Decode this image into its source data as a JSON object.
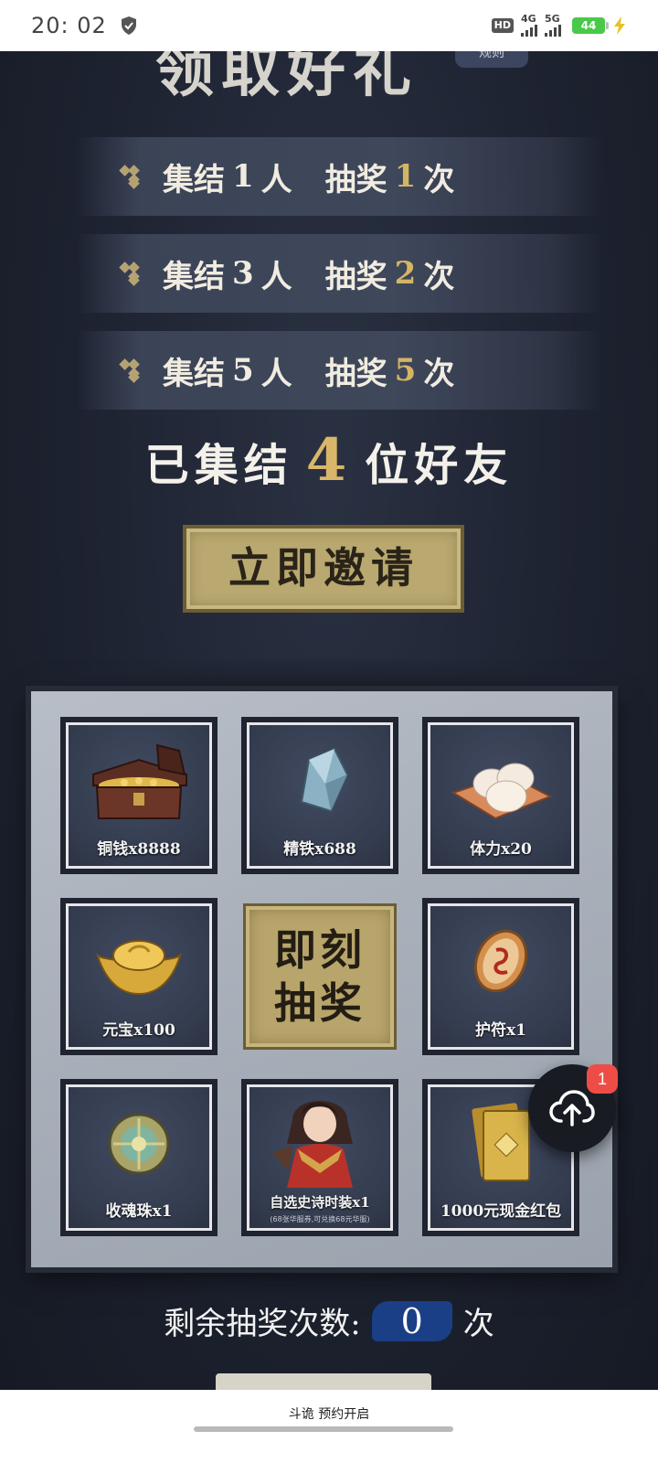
{
  "status_bar": {
    "time": "20: 02",
    "hd_label": "HD",
    "signal_1_label": "4G",
    "signal_2_label": "5G",
    "battery": "44"
  },
  "header": {
    "title_fragment": "领取好礼",
    "rules_label": "规则"
  },
  "tiers": [
    {
      "prefix": "集结",
      "people": "1",
      "people_unit": "人",
      "draw_text": "抽奖",
      "draws": "1",
      "draw_unit": "次"
    },
    {
      "prefix": "集结",
      "people": "3",
      "people_unit": "人",
      "draw_text": "抽奖",
      "draws": "2",
      "draw_unit": "次"
    },
    {
      "prefix": "集结",
      "people": "5",
      "people_unit": "人",
      "draw_text": "抽奖",
      "draws": "5",
      "draw_unit": "次"
    }
  ],
  "gathered": {
    "before": "已集结",
    "count": "4",
    "after": "位好友"
  },
  "invite_button": "立即邀请",
  "prizes": [
    {
      "label": "铜钱x8888"
    },
    {
      "label": "精铁x688"
    },
    {
      "label": "体力x20"
    },
    {
      "label": "元宝x100"
    },
    {
      "label": "护符x1"
    },
    {
      "label": "收魂珠x1"
    },
    {
      "label": "自选史诗时装x1",
      "sub": "(68张华服券,可兑换68元华服)"
    },
    {
      "label": "1000元现金红包"
    }
  ],
  "draw_button": {
    "line1": "即刻",
    "line2": "抽奖"
  },
  "remaining": {
    "label": "剩余抽奖次数:",
    "value": "0",
    "unit": "次"
  },
  "upload_badge": "1",
  "footer": {
    "text": "斗诡 预约开启"
  }
}
